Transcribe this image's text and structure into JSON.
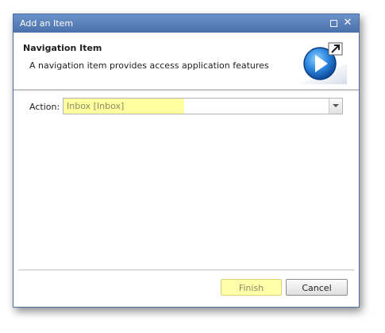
{
  "window": {
    "title": "Add an Item",
    "maximize_icon": "maximize-icon",
    "close_icon": "close-icon",
    "close_glyph": "✕"
  },
  "header": {
    "title": "Navigation Item",
    "description": "A navigation item provides access application features",
    "icon": "navigation-item-icon"
  },
  "form": {
    "action_label": "Action:",
    "action_value": "Inbox [Inbox]",
    "dropdown_icon": "chevron-down-icon"
  },
  "buttons": {
    "finish_label": "Finish",
    "cancel_label": "Cancel"
  },
  "colors": {
    "titlebar": "#5b82bb",
    "highlight": "#ffffa0",
    "icon_blue": "#1c6fc9"
  }
}
